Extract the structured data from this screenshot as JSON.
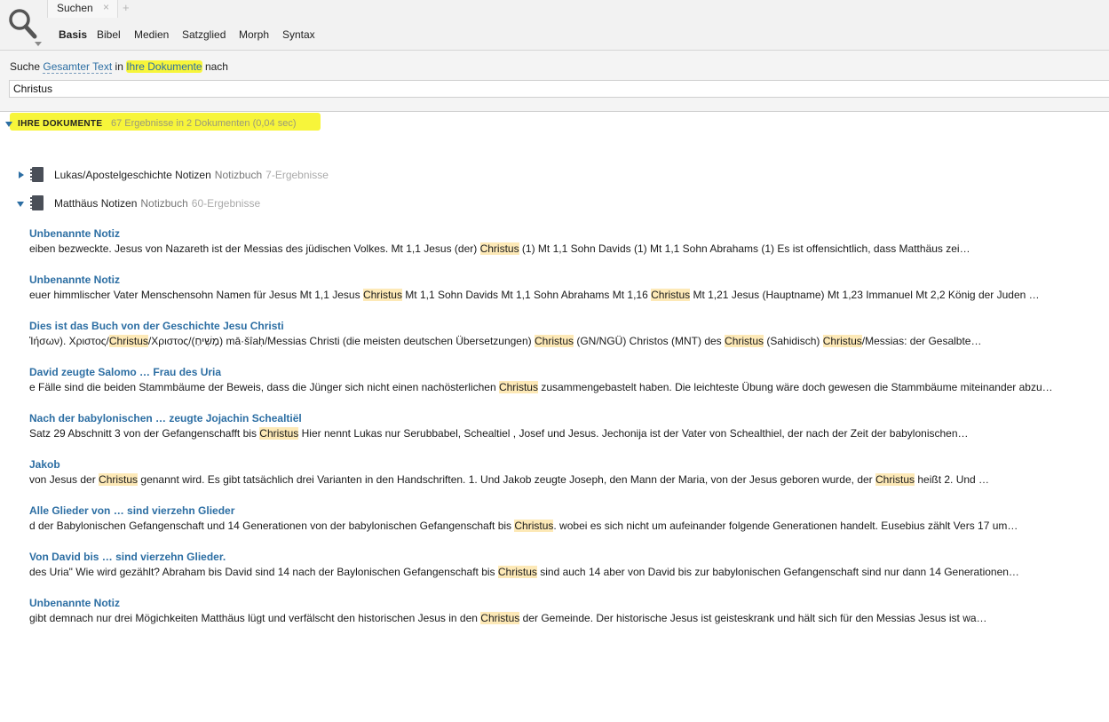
{
  "tab": {
    "label": "Suchen",
    "close": "×",
    "add": "+"
  },
  "subtabs": [
    "Basis",
    "Bibel",
    "Medien",
    "Satzglied",
    "Morph",
    "Syntax"
  ],
  "query": {
    "prefix": "Suche",
    "scope": "Gesamter Text",
    "in": "in",
    "target": "Ihre Dokumente",
    "suffix": "nach",
    "value": "Christus"
  },
  "results": {
    "title": "IHRE DOKUMENTE",
    "count": "67 Ergebnisse in 2 Dokumenten (0,04 sec)"
  },
  "documents": [
    {
      "name": "Lukas/Apostelgeschichte Notizen",
      "type": "Notizbuch",
      "count": "7-Ergebnisse",
      "expanded": false
    },
    {
      "name": "Matthäus Notizen",
      "type": "Notizbuch",
      "count": "60-Ergebnisse",
      "expanded": true
    }
  ],
  "hits": [
    {
      "title": "Unbenannte Notiz",
      "parts": [
        {
          "t": "eiben bezweckte.   Jesus von Nazareth ist der Messias des jüdischen Volkes.  Mt 1,1 Jesus (der) "
        },
        {
          "t": "Christus",
          "m": true
        },
        {
          "t": " (1) Mt 1,1 Sohn Davids (1) Mt 1,1 Sohn Abrahams (1)   Es ist offensichtlich, dass  Matthäus zei…"
        }
      ]
    },
    {
      "title": "Unbenannte Notiz",
      "parts": [
        {
          "t": "euer himmlischer Vater Menschensohn  Namen für Jesus Mt 1,1 Jesus "
        },
        {
          "t": "Christus",
          "m": true
        },
        {
          "t": " Mt 1,1 Sohn Davids Mt 1,1 Sohn Abrahams Mt 1,16 "
        },
        {
          "t": "Christus",
          "m": true
        },
        {
          "t": " Mt 1,21 Jesus (Hauptname) Mt 1,23 Immanuel Mt 2,2 König der Juden  …"
        }
      ]
    },
    {
      "title": "Dies ist das Buch von der Geschichte Jesu Christi",
      "parts": [
        {
          "t": "Ἰήσων).    Χριστος/"
        },
        {
          "t": "Christus",
          "m": true
        },
        {
          "t": "/Χριστος/(מָשִׁיחַ) mā·šîaḥ/Messias Christi (die meisten deutschen Übersetzungen) "
        },
        {
          "t": "Christus",
          "m": true
        },
        {
          "t": " (GN/NGÜ) Christos (MNT) des "
        },
        {
          "t": "Christus",
          "m": true
        },
        {
          "t": " (Sahidisch)  "
        },
        {
          "t": "Christus",
          "m": true
        },
        {
          "t": "/Messias: der Gesalbte…"
        }
      ]
    },
    {
      "title": "David zeugte Salomo … Frau des Uria",
      "parts": [
        {
          "t": "e Fälle sind die beiden Stammbäume der Beweis, dass die Jünger sich nicht einen nachösterlichen "
        },
        {
          "t": "Christus",
          "m": true
        },
        {
          "t": " zusammengebastelt haben. Die leichteste Übung wäre doch gewesen die Stammbäume miteinander abzu…"
        }
      ]
    },
    {
      "title": "Nach der babylonischen … zeugte Jojachin Schealtiël",
      "parts": [
        {
          "t": "Satz 29  Abschnitt 3 von der Gefangenschafft bis "
        },
        {
          "t": "Christus",
          "m": true
        },
        {
          "t": " Hier nennt Lukas nur Serubbabel, Schealtiel , Josef und Jesus.  Jechonija ist der Vater von Schealthiel, der nach der Zeit der babylonischen…"
        }
      ]
    },
    {
      "title": "Jakob",
      "parts": [
        {
          "t": "von Jesus der "
        },
        {
          "t": "Christus",
          "m": true
        },
        {
          "t": " genannt wird.  Es gibt tatsächlich drei Varianten in den Handschriften.  1. Und Jakob zeugte Joseph, den Mann der Maria, von der Jesus geboren wurde, der "
        },
        {
          "t": "Christus",
          "m": true
        },
        {
          "t": " heißt  2. Und …"
        }
      ]
    },
    {
      "title": "Alle Glieder von … sind vierzehn Glieder",
      "parts": [
        {
          "t": "d der Babylonischen Gefangenschaft und 14 Generationen von der babylonischen Gefangenschaft bis "
        },
        {
          "t": "Christus",
          "m": true
        },
        {
          "t": ".  wobei es sich nicht um aufeinander folgende Generationen handelt.   Eusebius zählt Vers 17 um…"
        }
      ]
    },
    {
      "title": "Von David bis … sind vierzehn Glieder.",
      "parts": [
        {
          "t": "des Uria\"  Wie wird gezählt? Abraham bis David sind 14 nach der Baylonischen Gefangenschaft bis "
        },
        {
          "t": "Christus",
          "m": true
        },
        {
          "t": " sind auch 14  aber von David bis zur babylonischen Gefangenschaft sind nur dann 14 Generationen…"
        }
      ]
    },
    {
      "title": "Unbenannte Notiz",
      "parts": [
        {
          "t": "gibt demnach nur drei Mögichkeiten  Matthäus lügt und verfälscht den historischen Jesus in den "
        },
        {
          "t": "Christus",
          "m": true
        },
        {
          "t": " der Gemeinde. Der historische Jesus ist geisteskrank und hält sich für den Messias Jesus ist wa…"
        }
      ]
    }
  ],
  "colors": {
    "link": "#2c6ea3",
    "highlight": "#f7f53a",
    "match": "#fde9b7"
  },
  "icons": {
    "search": "magnifier-icon",
    "notebook": "notebook-icon"
  }
}
